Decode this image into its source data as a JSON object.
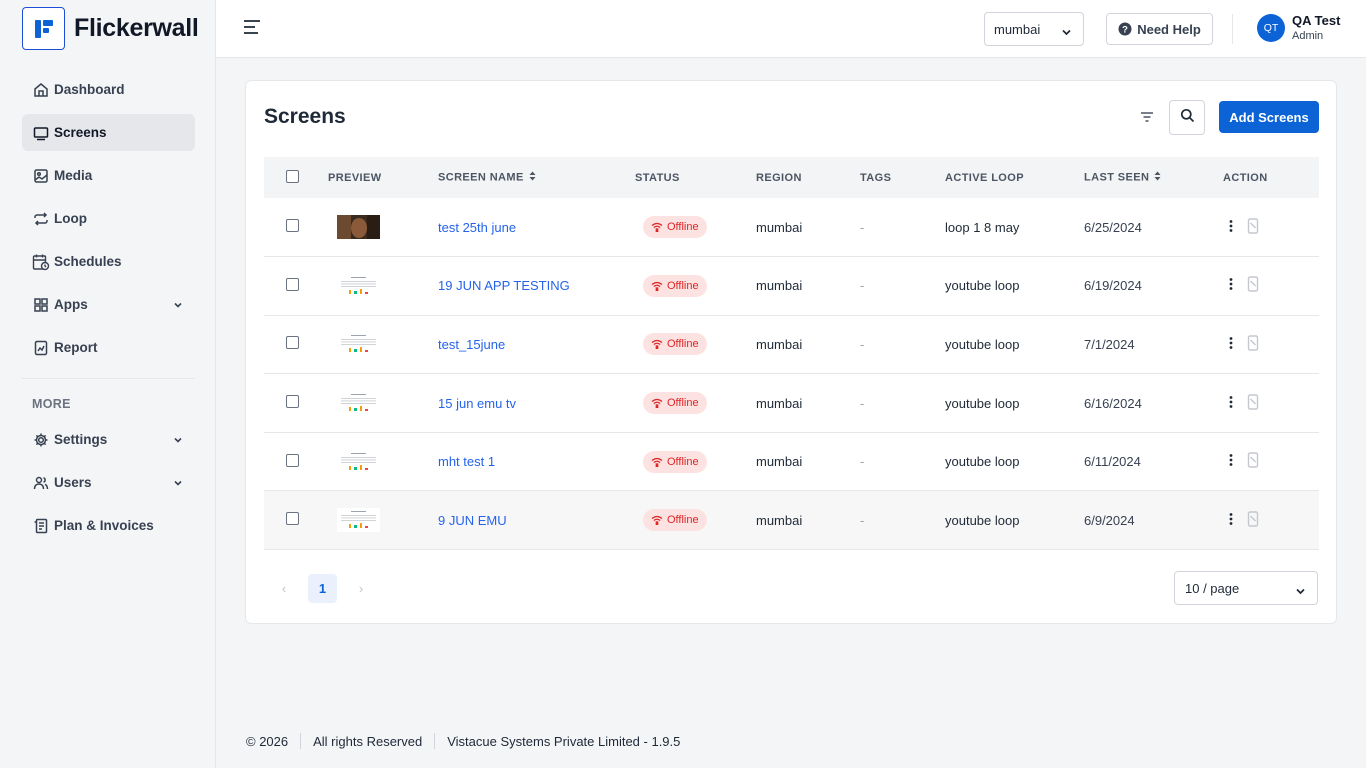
{
  "app": {
    "name": "Flickerwall"
  },
  "sidebar": {
    "items": [
      {
        "label": "Dashboard",
        "icon": "home-icon"
      },
      {
        "label": "Screens",
        "icon": "monitor-icon",
        "active": true
      },
      {
        "label": "Media",
        "icon": "image-icon"
      },
      {
        "label": "Loop",
        "icon": "repeat-icon"
      },
      {
        "label": "Schedules",
        "icon": "calendar-clock-icon"
      },
      {
        "label": "Apps",
        "icon": "grid-icon",
        "expandable": true
      },
      {
        "label": "Report",
        "icon": "chart-file-icon"
      }
    ],
    "more_label": "MORE",
    "more_items": [
      {
        "label": "Settings",
        "icon": "gear-icon",
        "expandable": true
      },
      {
        "label": "Users",
        "icon": "users-icon",
        "expandable": true
      },
      {
        "label": "Plan & Invoices",
        "icon": "invoice-icon"
      }
    ]
  },
  "header": {
    "region": "mumbai",
    "help_label": "Need Help",
    "user": {
      "initials": "QT",
      "name": "QA Test",
      "role": "Admin"
    }
  },
  "main": {
    "title": "Screens",
    "add_button": "Add Screens",
    "columns": [
      "PREVIEW",
      "SCREEN NAME",
      "STATUS",
      "REGION",
      "TAGS",
      "ACTIVE LOOP",
      "LAST SEEN",
      "ACTION"
    ],
    "rows": [
      {
        "name": "test 25th june",
        "status": "Offline",
        "region": "mumbai",
        "tags": "-",
        "loop": "loop 1 8 may",
        "last_seen": "6/25/2024",
        "preview": "photo"
      },
      {
        "name": "19 JUN APP TESTING",
        "status": "Offline",
        "region": "mumbai",
        "tags": "-",
        "loop": "youtube loop",
        "last_seen": "6/19/2024",
        "preview": "doc"
      },
      {
        "name": "test_15june",
        "status": "Offline",
        "region": "mumbai",
        "tags": "-",
        "loop": "youtube loop",
        "last_seen": "7/1/2024",
        "preview": "doc"
      },
      {
        "name": "15 jun emu tv",
        "status": "Offline",
        "region": "mumbai",
        "tags": "-",
        "loop": "youtube loop",
        "last_seen": "6/16/2024",
        "preview": "doc"
      },
      {
        "name": "mht test 1",
        "status": "Offline",
        "region": "mumbai",
        "tags": "-",
        "loop": "youtube loop",
        "last_seen": "6/11/2024",
        "preview": "doc"
      },
      {
        "name": "9 JUN EMU",
        "status": "Offline",
        "region": "mumbai",
        "tags": "-",
        "loop": "youtube loop",
        "last_seen": "6/9/2024",
        "preview": "doc"
      }
    ],
    "pagination": {
      "current": "1",
      "per_page": "10 / page"
    }
  },
  "footer": {
    "copyright": "© 2026",
    "rights": "All rights Reserved",
    "company": "Vistacue Systems Private Limited - 1.9.5"
  },
  "colors": {
    "accent": "#0b63d6",
    "offline_bg": "#fde2e2",
    "offline_text": "#dc2626",
    "link": "#2563eb"
  }
}
